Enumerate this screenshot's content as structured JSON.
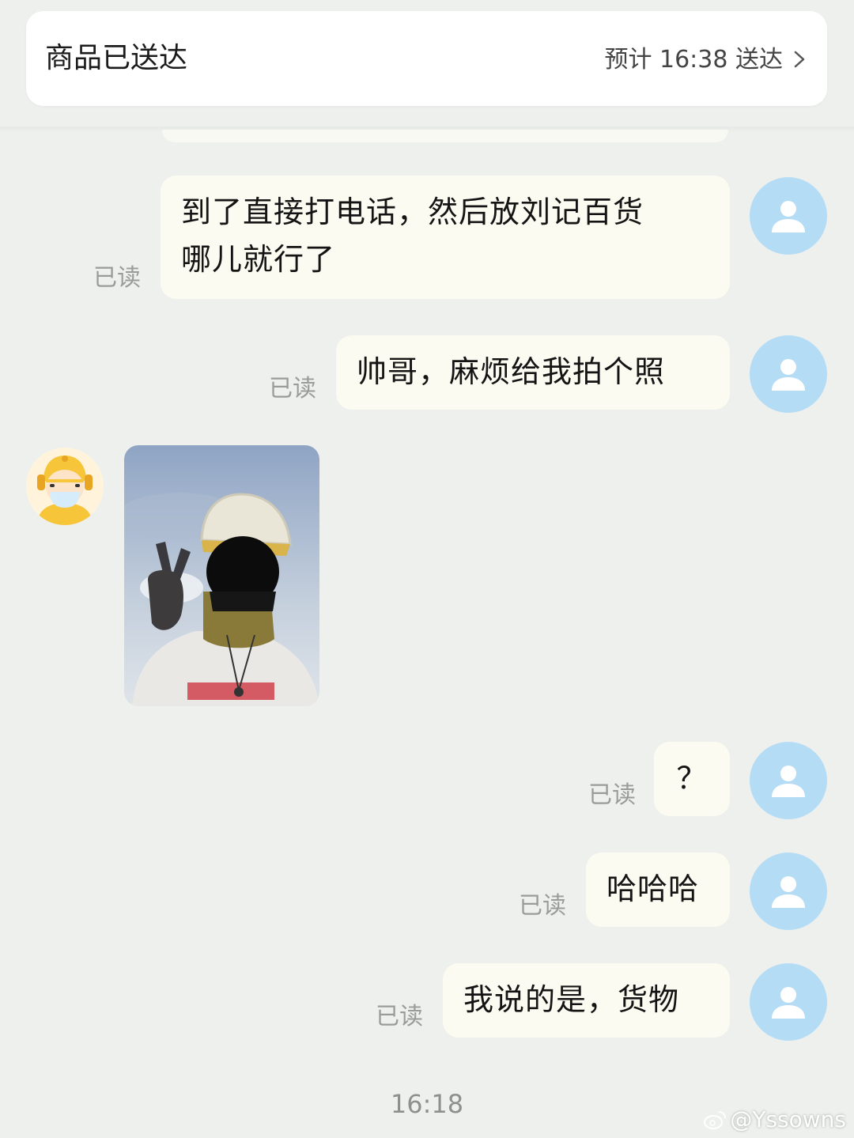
{
  "status_card": {
    "title": "商品已送达",
    "eta": "预计 16:38 送达",
    "chevron_icon": "chevron-right-icon"
  },
  "messages": [
    {
      "sender": "user",
      "text_line1": "到了直接打电话，然后放刘记百货",
      "text_line2": "哪儿就行了",
      "read": "已读"
    },
    {
      "sender": "user",
      "text": "帅哥，麻烦给我拍个照",
      "read": "已读"
    },
    {
      "sender": "courier",
      "type": "photo",
      "avatar_icon": "courier-avatar-icon"
    },
    {
      "sender": "user",
      "text": "？",
      "read": "已读"
    },
    {
      "sender": "user",
      "text": "哈哈哈",
      "read": "已读"
    },
    {
      "sender": "user",
      "text": "我说的是，货物",
      "read": "已读"
    }
  ],
  "timestamp": "16:18",
  "watermark": "@Yssowns",
  "colors": {
    "background": "#eef0ee",
    "bubble": "#fbfbf1",
    "user_avatar": "#b5dcf5",
    "read_label": "#9a9c9a"
  }
}
